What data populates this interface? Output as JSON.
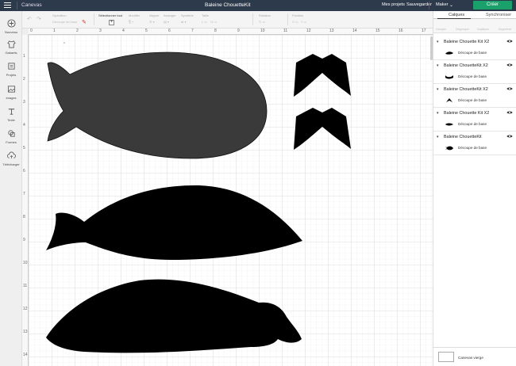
{
  "topbar": {
    "app_name": "Canevas",
    "project_name": "Baleine ChouetteKit",
    "my_projects": "Mes projets",
    "save": "Sauvegarder",
    "machine": "Maker",
    "make_button": "Créer"
  },
  "toolbar": {
    "operation_label": "Opération",
    "operation_value": "Découpe de base",
    "select_all": "Sélectionner tout",
    "edit": "Modifier",
    "align": "Aligner",
    "arrange": "Arranger",
    "flip": "Symétrie",
    "size": "Taille",
    "rotate": "Rotation",
    "position": "Position"
  },
  "sidebar": {
    "items": [
      {
        "label": "Nouveau",
        "icon": "plus-circle-icon"
      },
      {
        "label": "Gabarits",
        "icon": "shirt-icon"
      },
      {
        "label": "Projets",
        "icon": "projects-icon"
      },
      {
        "label": "Images",
        "icon": "image-icon"
      },
      {
        "label": "Texte",
        "icon": "text-icon"
      },
      {
        "label": "Formes",
        "icon": "shapes-icon"
      },
      {
        "label": "Télécharger",
        "icon": "upload-icon"
      }
    ]
  },
  "ruler": {
    "top": [
      "0",
      "1",
      "2",
      "3",
      "4",
      "5",
      "6",
      "7",
      "8",
      "9",
      "10",
      "11",
      "12",
      "13",
      "14",
      "15",
      "16",
      "17"
    ],
    "left": [
      "1",
      "2",
      "3",
      "4",
      "5",
      "6",
      "7",
      "8",
      "9",
      "10",
      "11",
      "12",
      "13",
      "14"
    ]
  },
  "panel": {
    "tab_layers": "Calques",
    "tab_sync": "Synchroniser",
    "tools": [
      "Grouper",
      "Dégrouper",
      "Dupliquer",
      "Supprimer"
    ],
    "layers": [
      {
        "name": "Baleine Chouette Kit X2",
        "sub": "Découpe de base"
      },
      {
        "name": "Baleine ChouetteKit X2",
        "sub": "Découpe de base"
      },
      {
        "name": "Baleine ChouetteKit X2",
        "sub": "Découpe de base"
      },
      {
        "name": "Baleine Chouette Kit X2",
        "sub": "Découpe de base"
      },
      {
        "name": "Baleine ChouetteKit",
        "sub": "Découpe de base"
      }
    ],
    "blank_canvas": "Canevas vierge"
  },
  "colors": {
    "topbar": "#2d3a4b",
    "make_button": "#1aa06b",
    "shape_dark": "#3a3a3a",
    "shape_black": "#000000"
  }
}
